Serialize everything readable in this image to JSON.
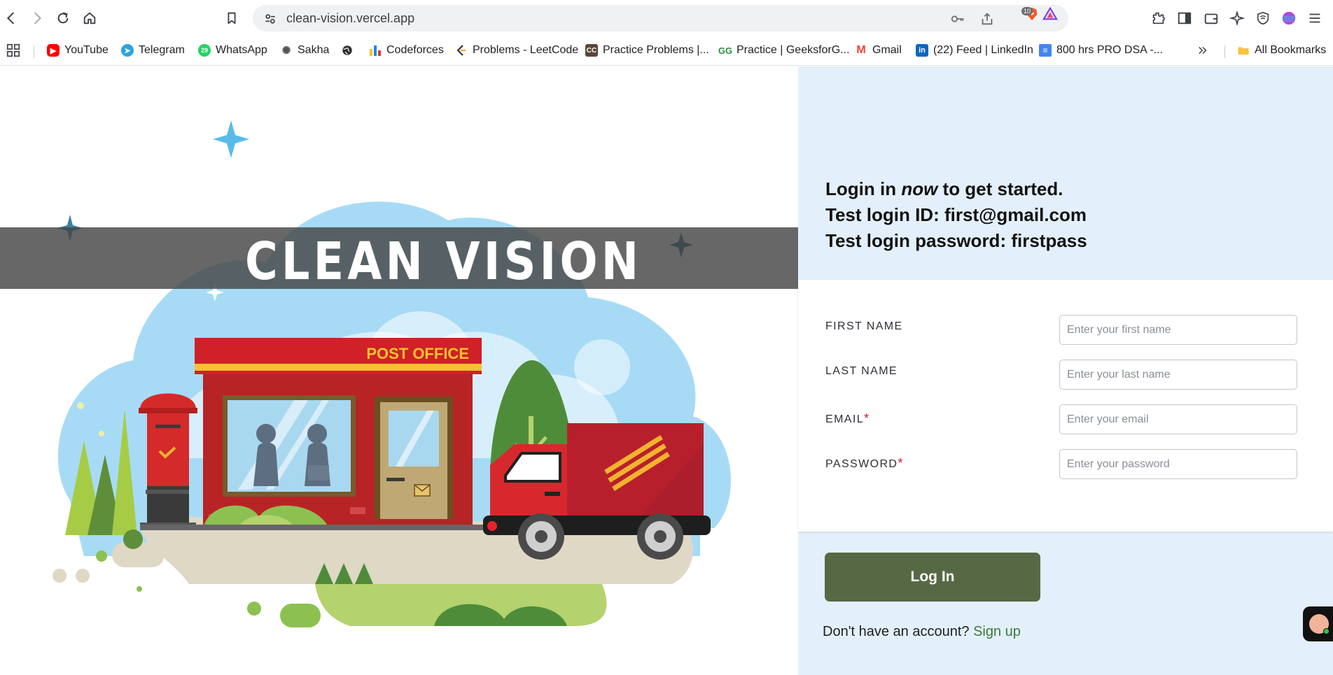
{
  "browser": {
    "url": "clean-vision.vercel.app",
    "brave_shield_count": "10",
    "bookmarks": [
      {
        "label": "YouTube",
        "icon": "youtube-icon",
        "color": "#ff0000"
      },
      {
        "label": "Telegram",
        "icon": "telegram-icon",
        "color": "#2aa3df"
      },
      {
        "label": "WhatsApp",
        "icon": "whatsapp-icon",
        "color": "#25d366",
        "badge": "29"
      },
      {
        "label": "Sakha",
        "icon": "sakha-icon",
        "color": "#555555"
      },
      {
        "label": "",
        "icon": "globe-icon",
        "color": "#333333"
      },
      {
        "label": "Codeforces",
        "icon": "codeforces-icon",
        "color": "#1e88e5"
      },
      {
        "label": "Problems - LeetCode",
        "icon": "leetcode-icon",
        "color": "#ffa116"
      },
      {
        "label": "Practice Problems |...",
        "icon": "codechef-icon",
        "color": "#5b4638"
      },
      {
        "label": "Practice | GeeksforG...",
        "icon": "geeksforgeeks-icon",
        "color": "#2f8d46"
      },
      {
        "label": "Gmail",
        "icon": "gmail-icon",
        "color": "#ea4335"
      },
      {
        "label": "(22) Feed | LinkedIn",
        "icon": "linkedin-icon",
        "color": "#0a66c2"
      },
      {
        "label": "800 hrs PRO DSA -...",
        "icon": "docs-icon",
        "color": "#4285f4"
      }
    ],
    "all_bookmarks": "All Bookmarks"
  },
  "hero": {
    "title": "CLEAN VISION",
    "sign_text": "POST OFFICE"
  },
  "login": {
    "intro_line1_before": "Login in ",
    "intro_line1_em": "now",
    "intro_line1_after": " to get started.",
    "intro_line2": "Test login ID: first@gmail.com",
    "intro_line3": "Test login password: firstpass",
    "fields": [
      {
        "label": "FIRST NAME",
        "required": false,
        "placeholder": "Enter your first name"
      },
      {
        "label": "LAST NAME",
        "required": false,
        "placeholder": "Enter your last name"
      },
      {
        "label": "EMAIL",
        "required": true,
        "placeholder": "Enter your email"
      },
      {
        "label": "PASSWORD",
        "required": true,
        "placeholder": "Enter your password"
      }
    ],
    "required_mark": "*",
    "button_label": "Log In",
    "signup_prompt": "Don't have an account?",
    "signup_link": "Sign up"
  },
  "colors": {
    "side_panel": "#e3f0fb",
    "button": "#566944",
    "link": "#3b7a3a",
    "required": "#d01b2a"
  }
}
